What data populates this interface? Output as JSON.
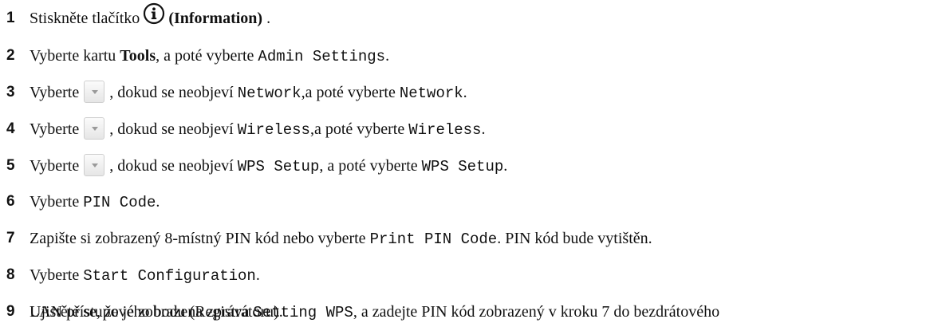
{
  "steps": [
    {
      "num": "1",
      "t1": "Stiskněte tlačítko",
      "icon": "info-icon",
      "t2": "(Information)",
      "t3": " ."
    },
    {
      "num": "2",
      "t1": "Vyberte kartu ",
      "t2": "Tools",
      "t3": ", a poté vyberte ",
      "t4": "Admin Settings",
      "t5": "."
    },
    {
      "num": "3",
      "t1": "Vyberte",
      "icon": "scroll-down-button",
      "t2": ", dokud se neobjeví ",
      "t3": "Network",
      "t4": ",a poté vyberte ",
      "t5": "Network",
      "t6": "."
    },
    {
      "num": "4",
      "t1": "Vyberte",
      "icon": "scroll-down-button",
      "t2": ", dokud se neobjeví ",
      "t3": "Wireless",
      "t4": ",a poté vyberte ",
      "t5": "Wireless",
      "t6": "."
    },
    {
      "num": "5",
      "t1": "Vyberte",
      "icon": "scroll-down-button",
      "t2": ", dokud se neobjeví ",
      "t3": "WPS Setup",
      "t4": ", a poté vyberte ",
      "t5": "WPS Setup",
      "t6": "."
    },
    {
      "num": "6",
      "t1": "Vyberte ",
      "t2": "PIN Code",
      "t3": "."
    },
    {
      "num": "7",
      "t1": "Zapište si zobrazený 8-místný PIN kód nebo vyberte ",
      "t2": "Print PIN Code",
      "t3": ". PIN kód bude vytištěn."
    },
    {
      "num": "8",
      "t1": "Vyberte ",
      "t2": "Start Configuration",
      "t3": "."
    },
    {
      "num": "9",
      "t1": "Ujistěte se, že je zobrazena zpráva ",
      "t2": "Setting WPS",
      "t3": ", a zadejte PIN kód zobrazený v kroku 7 do bezdrátového",
      "t4": "LAN přístupového bodu (Registrátoru)."
    }
  ]
}
